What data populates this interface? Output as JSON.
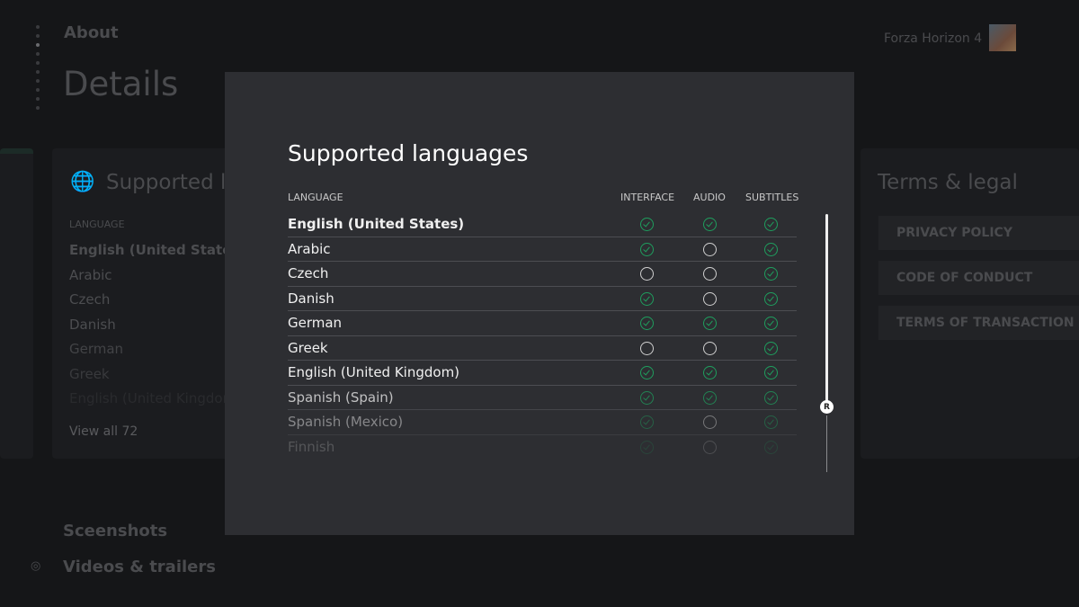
{
  "page": {
    "section": "About",
    "title": "Details",
    "game_title": "Forza Horizon 4"
  },
  "bg_languages": {
    "title": "Supported languages",
    "header": "LANGUAGE",
    "items": [
      "English (United States)",
      "Arabic",
      "Czech",
      "Danish",
      "German",
      "Greek",
      "English (United Kingdom)"
    ],
    "view_all": "View all 72"
  },
  "terms": {
    "title": "Terms & legal",
    "buttons": [
      "PRIVACY POLICY",
      "CODE OF CONDUCT",
      "TERMS OF TRANSACTION"
    ]
  },
  "bottom": {
    "screenshots": "Sceenshots",
    "videos": "Videos & trailers"
  },
  "modal": {
    "title": "Supported languages",
    "columns": [
      "LANGUAGE",
      "INTERFACE",
      "AUDIO",
      "SUBTITLES"
    ],
    "rows": [
      {
        "name": "English (United States)",
        "interface": true,
        "audio": true,
        "subtitles": true
      },
      {
        "name": "Arabic",
        "interface": true,
        "audio": false,
        "subtitles": true
      },
      {
        "name": "Czech",
        "interface": false,
        "audio": false,
        "subtitles": true
      },
      {
        "name": "Danish",
        "interface": true,
        "audio": false,
        "subtitles": true
      },
      {
        "name": "German",
        "interface": true,
        "audio": true,
        "subtitles": true
      },
      {
        "name": "Greek",
        "interface": false,
        "audio": false,
        "subtitles": true
      },
      {
        "name": "English (United Kingdom)",
        "interface": true,
        "audio": true,
        "subtitles": true
      },
      {
        "name": "Spanish (Spain)",
        "interface": true,
        "audio": true,
        "subtitles": true
      },
      {
        "name": "Spanish (Mexico)",
        "interface": true,
        "audio": false,
        "subtitles": true
      },
      {
        "name": "Finnish",
        "interface": true,
        "audio": false,
        "subtitles": true
      }
    ],
    "scroll_hint": "R",
    "colors": {
      "check": "#1f9e5e",
      "background": "#2d2e32"
    }
  }
}
